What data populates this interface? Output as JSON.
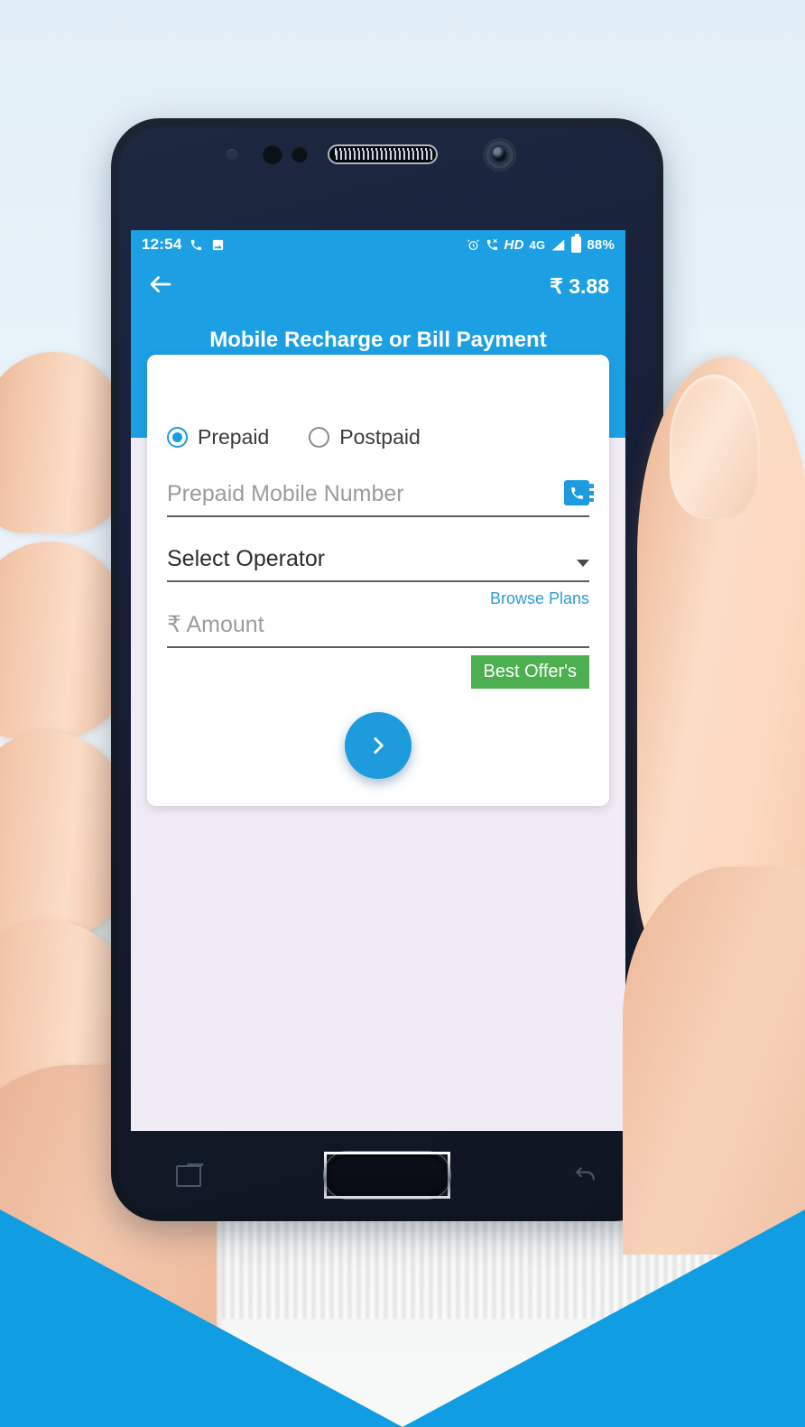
{
  "status_bar": {
    "time": "12:54",
    "left_icons": [
      "phone-icon",
      "image-icon"
    ],
    "right_icons": [
      "alarm-icon",
      "missed-call-icon",
      "signal-icon",
      "battery-icon"
    ],
    "hd_label": "HD",
    "network_label": "4G",
    "battery_percent": "88%"
  },
  "app_bar": {
    "back_icon": "arrow-left-icon",
    "balance": "₹ 3.88"
  },
  "hero": {
    "title": "Mobile Recharge or Bill Payment"
  },
  "form": {
    "connection_types": [
      {
        "label": "Prepaid",
        "selected": true
      },
      {
        "label": "Postpaid",
        "selected": false
      }
    ],
    "mobile_number": {
      "placeholder": "Prepaid Mobile Number",
      "value": "",
      "contacts_icon": "contacts-book-icon"
    },
    "operator": {
      "label": "Select Operator",
      "value": "Select Operator",
      "caret_icon": "chevron-down-icon"
    },
    "amount": {
      "placeholder": "₹ Amount",
      "value": ""
    },
    "browse_plans_label": "Browse Plans",
    "best_offer_label": "Best Offer's",
    "submit": {
      "icon": "chevron-right-icon",
      "label": ""
    }
  },
  "device": {
    "nav_recents_icon": "recents-icon",
    "nav_home_icon": "home-button",
    "nav_back_icon": "back-arrow-icon",
    "front_camera_icon": "camera-icon",
    "earpiece_icon": "earpiece-grille"
  },
  "colors": {
    "primary_blue": "#1ca0e3",
    "accent_blue": "#1d9bdd",
    "link_blue": "#2d9cdb",
    "offer_green": "#4caf50",
    "screen_bg": "#f0ecf5",
    "card_bg": "#ffffff",
    "placeholder_gray": "#9b9b9b"
  }
}
